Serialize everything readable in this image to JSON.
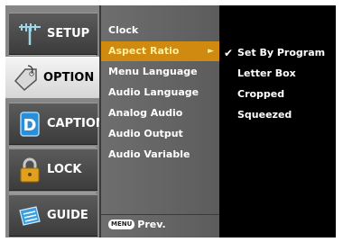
{
  "tabs": [
    {
      "label": "SETUP",
      "icon": "antenna-icon",
      "active": false
    },
    {
      "label": "OPTION",
      "icon": "tag-icon",
      "active": true
    },
    {
      "label": "CAPTION",
      "icon": "caption-icon",
      "active": false
    },
    {
      "label": "LOCK",
      "icon": "padlock-icon",
      "active": false
    },
    {
      "label": "GUIDE",
      "icon": "guide-book-icon",
      "active": false
    }
  ],
  "menu": {
    "items": [
      {
        "label": "Clock",
        "selected": false
      },
      {
        "label": "Aspect Ratio",
        "selected": true
      },
      {
        "label": "Menu Language",
        "selected": false
      },
      {
        "label": "Audio Language",
        "selected": false
      },
      {
        "label": "Analog Audio",
        "selected": false
      },
      {
        "label": "Audio Output",
        "selected": false
      },
      {
        "label": "Audio Variable",
        "selected": false
      }
    ],
    "submenu_arrow": "►",
    "footer_button": "MENU",
    "footer_label": "Prev."
  },
  "submenu": {
    "options": [
      {
        "label": "Set By Program",
        "checked": true
      },
      {
        "label": "Letter Box",
        "checked": false
      },
      {
        "label": "Cropped",
        "checked": false
      },
      {
        "label": "Squeezed",
        "checked": false
      }
    ],
    "check_mark": "✔"
  },
  "colors": {
    "selected_bg": "#d08a10",
    "selected_text": "#ffef9a",
    "menu_bg": "#666666",
    "screen_bg": "#000000"
  }
}
